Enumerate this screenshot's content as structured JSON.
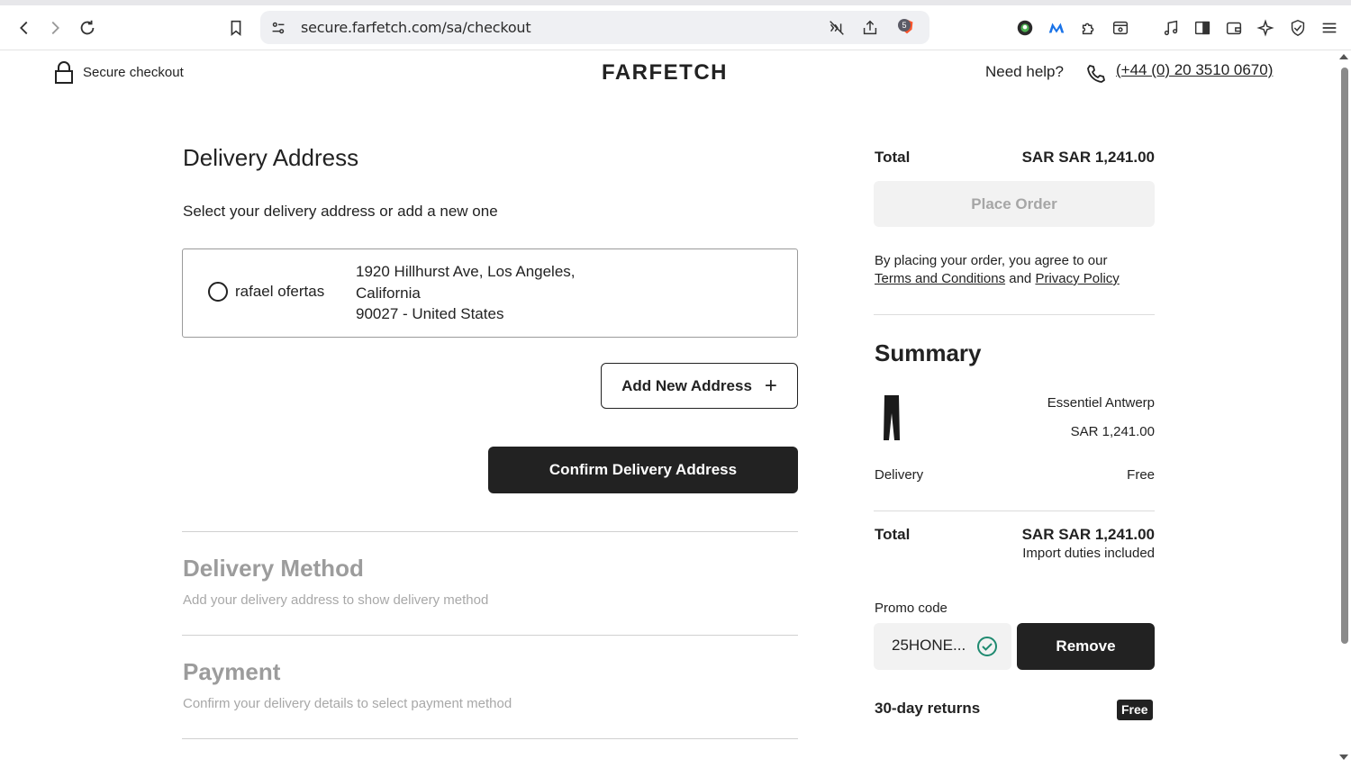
{
  "browser": {
    "url": "secure.farfetch.com/sa/checkout",
    "shield_count": "5",
    "icons": [
      "back-icon",
      "forward-icon",
      "reload-icon",
      "bookmark-icon",
      "site-settings-icon",
      "reader-mode-off-icon",
      "share-icon",
      "brave-shield-icon",
      "extension-avatar-icon",
      "extension-m-icon",
      "extensions-puzzle-icon",
      "tab-search-icon",
      "media-icon",
      "sidebar-icon",
      "wallet-icon",
      "leo-ai-icon",
      "vpn-shield-icon",
      "menu-icon"
    ]
  },
  "header": {
    "secure_label": "Secure checkout",
    "logo": "FARFETCH",
    "help_label": "Need help?",
    "phone": "(+44 (0) 20 3510 0670)"
  },
  "delivery": {
    "title": "Delivery Address",
    "subtitle": "Select your delivery address or add a new one",
    "address": {
      "name": "rafael ofertas",
      "line1": "1920 Hillhurst Ave, Los Angeles,",
      "line2": "California",
      "line3": "90027 - United States"
    },
    "add_new_label": "Add New Address",
    "add_new_icon": "+",
    "confirm_label": "Confirm Delivery Address"
  },
  "steps": [
    {
      "title": "Delivery Method",
      "subtitle": "Add your delivery address to show delivery method"
    },
    {
      "title": "Payment",
      "subtitle": "Confirm your delivery details to select payment method"
    }
  ],
  "order": {
    "total_label": "Total",
    "total_value": "SAR SAR 1,241.00",
    "place_order_label": "Place Order",
    "agree_prefix": "By placing your order, you agree to our",
    "terms_link": "Terms and Conditions",
    "and_text": "and",
    "privacy_link": "Privacy Policy"
  },
  "summary": {
    "title": "Summary",
    "product_brand": "Essentiel Antwerp",
    "product_price": "SAR 1,241.00",
    "delivery_label": "Delivery",
    "delivery_value": "Free",
    "total_label": "Total",
    "total_value": "SAR SAR 1,241.00",
    "duties_note": "Import duties included",
    "promo_label": "Promo code",
    "promo_code": "25HONE...",
    "remove_label": "Remove",
    "returns_label": "30-day returns",
    "returns_badge": "Free"
  },
  "colors": {
    "primary_dark": "#222222",
    "muted_text": "#9c9c9c",
    "disabled_bg": "#f2f2f2",
    "success_green": "#1f8a70"
  }
}
